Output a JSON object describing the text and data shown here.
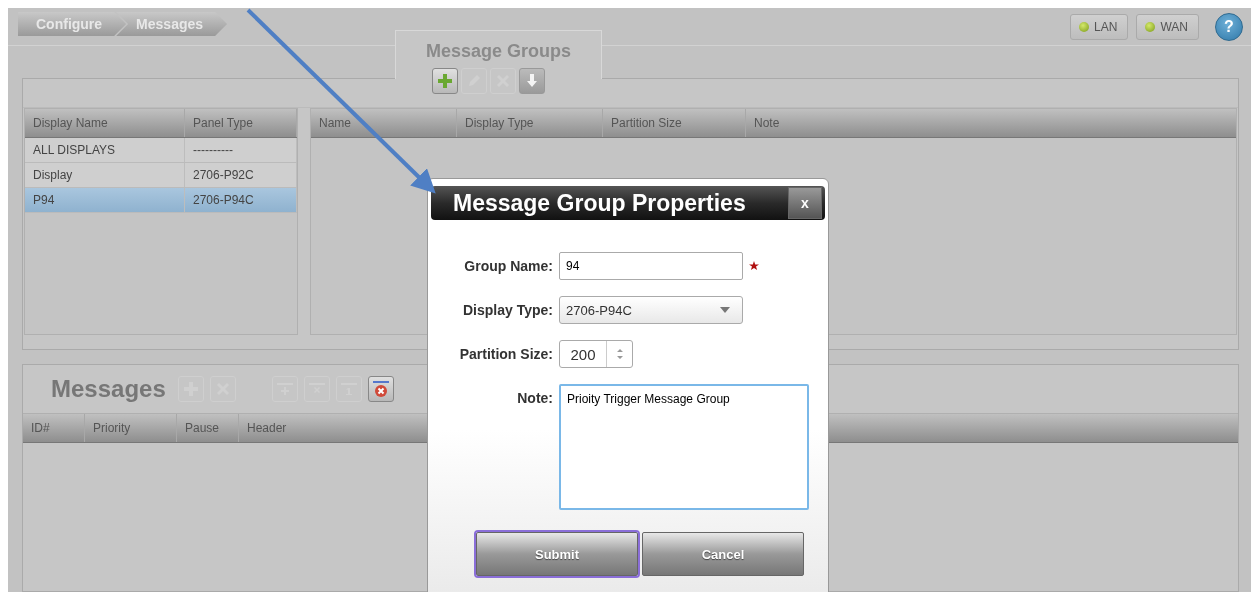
{
  "breadcrumb": [
    {
      "label": "Configure"
    },
    {
      "label": "Messages"
    }
  ],
  "status": [
    {
      "label": "LAN",
      "on": true
    },
    {
      "label": "WAN",
      "on": true
    }
  ],
  "help": {
    "label": "?"
  },
  "tab": {
    "label": "Message Groups",
    "selected": true
  },
  "group_toolbar": [
    {
      "kind": "plus",
      "disabled": false
    },
    {
      "kind": "pencil",
      "disabled": true
    },
    {
      "kind": "cross",
      "disabled": true
    },
    {
      "kind": "download",
      "disabled": false
    }
  ],
  "displays_table": {
    "columns": [
      "Display Name",
      "Panel Type"
    ],
    "rows": [
      {
        "cells": [
          "ALL DISPLAYS",
          "----------"
        ],
        "selected": false
      },
      {
        "cells": [
          "Display",
          "2706-P92C"
        ],
        "selected": false
      },
      {
        "cells": [
          "P94",
          "2706-P94C"
        ],
        "selected": true
      }
    ]
  },
  "groups_table": {
    "columns": [
      "Name",
      "Display Type",
      "Partition Size",
      "Note"
    ]
  },
  "messages": {
    "title": "Messages",
    "toolbar": [
      {
        "kind": "plus",
        "disabled": true
      },
      {
        "kind": "cross",
        "disabled": true
      },
      {
        "kind": "row-plus",
        "disabled": true
      },
      {
        "kind": "row-cross",
        "disabled": true
      },
      {
        "kind": "row-number",
        "disabled": true
      },
      {
        "kind": "row-clear",
        "disabled": false
      }
    ],
    "columns": [
      "ID#",
      "Priority",
      "Pause",
      "Header"
    ]
  },
  "dialog": {
    "title": "Message Group Properties",
    "close": "x",
    "fields": [
      {
        "kind": "text",
        "label": "Group Name:",
        "value": "94",
        "required": true
      },
      {
        "kind": "select",
        "label": "Display Type:",
        "value": "2706-P94C",
        "required": false
      },
      {
        "kind": "spin",
        "label": "Partition Size:",
        "value": "200",
        "required": false
      },
      {
        "kind": "textarea",
        "label": "Note:",
        "value": "Prioity Trigger Message Group",
        "required": false
      }
    ],
    "buttons": [
      {
        "label": "Submit",
        "focused": true
      },
      {
        "label": "Cancel",
        "focused": false
      }
    ]
  }
}
